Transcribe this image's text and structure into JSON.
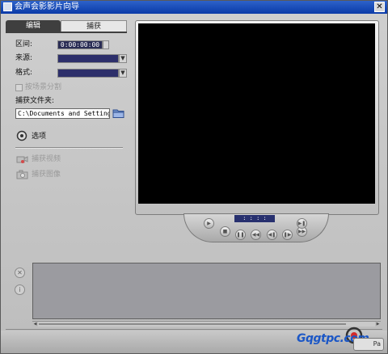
{
  "window": {
    "title": "会声会影影片向导",
    "close_glyph": "✕"
  },
  "tabs": {
    "edit_label": "编辑",
    "capture_label": "捕获"
  },
  "fields": {
    "interval_label": "区间:",
    "interval_value": "0:00:00:00",
    "source_label": "来源:",
    "format_label": "格式:",
    "split_by_scene_label": "按场景分割",
    "capture_folder_label": "捕获文件夹:",
    "capture_folder_value": "C:\\Documents and Setting"
  },
  "actions": {
    "options_label": "选项",
    "capture_video_label": "捕获视频",
    "capture_image_label": "捕获图像"
  },
  "transport": {
    "timecode": ": : : :",
    "buttons": [
      "play",
      "stop",
      "pause",
      "rewind",
      "step-back",
      "step-forward",
      "fast-forward",
      "end"
    ]
  },
  "footer": {
    "next_label": "Pa",
    "watermark_text": "Gqgtpc.com"
  },
  "icons": {
    "app": "app-icon",
    "folder": "folder-icon",
    "options": "options-icon",
    "capture_video": "camcorder-icon",
    "capture_image": "camera-icon",
    "storyboard_close": "close-icon",
    "storyboard_info": "info-icon"
  },
  "colors": {
    "titlebar": "#0a3aa8",
    "preview": "#000000",
    "storyboard": "#9b9ba0",
    "combo": "#2d2f6b"
  }
}
